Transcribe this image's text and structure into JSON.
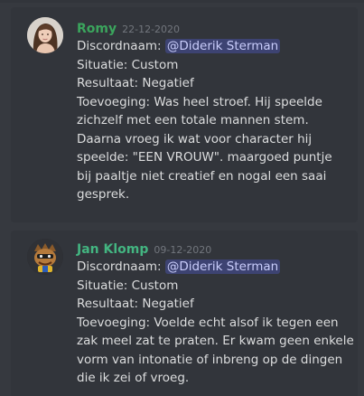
{
  "colors": {
    "romy_name": "#3ba55d",
    "jan_name": "#43b581",
    "background": "#36393f",
    "message_bg": "#32353b",
    "text": "#dcddde",
    "mention_text": "#c9cdfb"
  },
  "messages": [
    {
      "author": "Romy",
      "timestamp": "22-12-2020",
      "name_label": "Discordnaam: ",
      "mention": "@Diderik Sterman",
      "situation": "Situatie: Custom",
      "result": "Resultaat: Negatief",
      "addition_lines": [
        "Toevoeging: Was heel stroef. Hij speelde",
        "zichzelf met een totale mannen stem.",
        "Daarna vroeg ik wat voor character hij",
        "speelde: \"EEN VROUW\". maargoed puntje",
        "bij paaltje niet creatief en nogal een saai",
        "gesprek."
      ]
    },
    {
      "author": "Jan Klomp",
      "timestamp": "09-12-2020",
      "name_label": "Discordnaam: ",
      "mention": "@Diderik Sterman",
      "situation": "Situatie: Custom",
      "result": "Resultaat: Negatief",
      "addition_lines": [
        "Toevoeging: Voelde echt alsof ik tegen een",
        "zak meel zat te praten. Er kwam geen enkele",
        "vorm van intonatie of inbreng op de dingen",
        "die ik zei of vroeg."
      ]
    }
  ]
}
